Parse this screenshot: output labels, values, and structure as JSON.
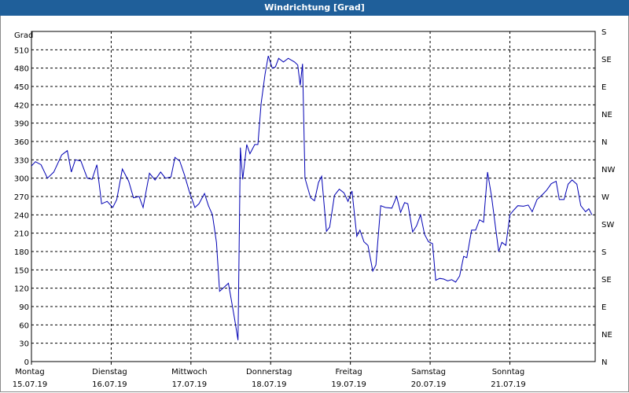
{
  "window": {
    "title": "Windrichtung [Grad]"
  },
  "colors": {
    "titlebar": "#1f5f9a",
    "line": "#0000b4",
    "grid": "#000000"
  },
  "chart_data": {
    "type": "line",
    "title": "Windrichtung [Grad]",
    "ylabel": "Grad",
    "ylim": [
      0,
      540
    ],
    "yticks": [
      0,
      30,
      60,
      90,
      120,
      150,
      180,
      210,
      240,
      270,
      300,
      330,
      360,
      390,
      420,
      450,
      480,
      510
    ],
    "right_axis_labels": [
      {
        "value": 0,
        "label": "N"
      },
      {
        "value": 30,
        "label": "NE"
      },
      {
        "value": 75,
        "label": "E"
      },
      {
        "value": 90,
        "label": ""
      },
      {
        "value": 105,
        "label": "SE"
      },
      {
        "value": 135,
        "label": "S"
      },
      {
        "value": 165,
        "label": "SW"
      },
      {
        "value": 195,
        "label": "W"
      },
      {
        "value": 225,
        "label": "NW"
      },
      {
        "value": 255,
        "label": "N"
      },
      {
        "value": 285,
        "label": "NE"
      },
      {
        "value": 315,
        "label": "E"
      },
      {
        "value": 345,
        "label": "SE"
      },
      {
        "value": 375,
        "label": "S"
      },
      {
        "value": 405,
        "label": "SW"
      },
      {
        "value": 435,
        "label": "W"
      },
      {
        "value": 465,
        "label": "NW"
      },
      {
        "value": 495,
        "label": "N"
      },
      {
        "value": 525,
        "label": "NE"
      }
    ],
    "right_axis_display": [
      {
        "value": 0,
        "label": "N"
      },
      {
        "value": 30,
        "label": "NE"
      },
      {
        "value": 60,
        "label": "E"
      },
      {
        "value": 90,
        "label": "SE"
      },
      {
        "value": 120,
        "label": "S"
      },
      {
        "value": 150,
        "label": "SW"
      },
      {
        "value": 180,
        "label": "W"
      },
      {
        "value": 210,
        "label": "NW"
      },
      {
        "value": 240,
        "label": "N"
      },
      {
        "value": 270,
        "label": "NE"
      },
      {
        "value": 300,
        "label": "E"
      },
      {
        "value": 330,
        "label": "SE"
      },
      {
        "value": 360,
        "label": "S"
      }
    ],
    "xlim": [
      0,
      7.07
    ],
    "day_labels": [
      {
        "day": "Montag",
        "date": "15.07.19"
      },
      {
        "day": "Dienstag",
        "date": "16.07.19"
      },
      {
        "day": "Mittwoch",
        "date": "17.07.19"
      },
      {
        "day": "Donnerstag",
        "date": "18.07.19"
      },
      {
        "day": "Freitag",
        "date": "19.07.19"
      },
      {
        "day": "Samstag",
        "date": "20.07.19"
      },
      {
        "day": "Sonntag",
        "date": "21.07.19"
      }
    ],
    "series": [
      {
        "points": [
          [
            0.0,
            320
          ],
          [
            0.05,
            327
          ],
          [
            0.12,
            322
          ],
          [
            0.2,
            300
          ],
          [
            0.28,
            310
          ],
          [
            0.38,
            338
          ],
          [
            0.45,
            345
          ],
          [
            0.5,
            310
          ],
          [
            0.55,
            330
          ],
          [
            0.62,
            328
          ],
          [
            0.7,
            300
          ],
          [
            0.76,
            298
          ],
          [
            0.82,
            322
          ],
          [
            0.88,
            258
          ],
          [
            0.95,
            262
          ],
          [
            1.02,
            252
          ],
          [
            1.07,
            265
          ],
          [
            1.14,
            315
          ],
          [
            1.22,
            295
          ],
          [
            1.28,
            268
          ],
          [
            1.35,
            270
          ],
          [
            1.4,
            252
          ],
          [
            1.48,
            308
          ],
          [
            1.55,
            297
          ],
          [
            1.62,
            310
          ],
          [
            1.68,
            300
          ],
          [
            1.75,
            302
          ],
          [
            1.8,
            334
          ],
          [
            1.86,
            328
          ],
          [
            1.92,
            305
          ],
          [
            1.98,
            278
          ],
          [
            2.05,
            252
          ],
          [
            2.1,
            258
          ],
          [
            2.17,
            275
          ],
          [
            2.22,
            255
          ],
          [
            2.27,
            240
          ],
          [
            2.32,
            195
          ],
          [
            2.36,
            115
          ],
          [
            2.42,
            122
          ],
          [
            2.47,
            128
          ],
          [
            2.51,
            98
          ],
          [
            2.55,
            68
          ],
          [
            2.59,
            35
          ],
          [
            2.62,
            350
          ],
          [
            2.65,
            298
          ],
          [
            2.7,
            355
          ],
          [
            2.74,
            340
          ],
          [
            2.8,
            355
          ],
          [
            2.84,
            355
          ],
          [
            2.88,
            422
          ],
          [
            2.93,
            470
          ],
          [
            2.97,
            500
          ],
          [
            3.02,
            480
          ],
          [
            3.06,
            482
          ],
          [
            3.1,
            496
          ],
          [
            3.16,
            490
          ],
          [
            3.22,
            496
          ],
          [
            3.3,
            490
          ],
          [
            3.34,
            485
          ],
          [
            3.37,
            452
          ],
          [
            3.4,
            487
          ],
          [
            3.43,
            300
          ],
          [
            3.5,
            268
          ],
          [
            3.55,
            263
          ],
          [
            3.6,
            293
          ],
          [
            3.64,
            303
          ],
          [
            3.7,
            213
          ],
          [
            3.74,
            220
          ],
          [
            3.8,
            272
          ],
          [
            3.86,
            282
          ],
          [
            3.92,
            276
          ],
          [
            3.97,
            262
          ],
          [
            4.02,
            279
          ],
          [
            4.08,
            205
          ],
          [
            4.12,
            215
          ],
          [
            4.17,
            196
          ],
          [
            4.22,
            190
          ],
          [
            4.28,
            148
          ],
          [
            4.32,
            158
          ],
          [
            4.38,
            255
          ],
          [
            4.44,
            252
          ],
          [
            4.52,
            251
          ],
          [
            4.58,
            270
          ],
          [
            4.63,
            244
          ],
          [
            4.68,
            260
          ],
          [
            4.72,
            258
          ],
          [
            4.78,
            212
          ],
          [
            4.83,
            222
          ],
          [
            4.88,
            240
          ],
          [
            4.93,
            208
          ],
          [
            4.98,
            196
          ],
          [
            5.03,
            193
          ],
          [
            5.07,
            133
          ],
          [
            5.12,
            136
          ],
          [
            5.17,
            135
          ],
          [
            5.22,
            132
          ],
          [
            5.27,
            134
          ],
          [
            5.32,
            130
          ],
          [
            5.37,
            140
          ],
          [
            5.42,
            172
          ],
          [
            5.46,
            170
          ],
          [
            5.52,
            215
          ],
          [
            5.57,
            215
          ],
          [
            5.62,
            232
          ],
          [
            5.67,
            228
          ],
          [
            5.72,
            310
          ],
          [
            5.77,
            270
          ],
          [
            5.82,
            220
          ],
          [
            5.86,
            180
          ],
          [
            5.9,
            195
          ],
          [
            5.95,
            190
          ],
          [
            6.0,
            240
          ],
          [
            6.05,
            248
          ],
          [
            6.1,
            255
          ],
          [
            6.17,
            254
          ],
          [
            6.23,
            256
          ],
          [
            6.28,
            245
          ],
          [
            6.34,
            265
          ],
          [
            6.4,
            272
          ],
          [
            6.46,
            280
          ],
          [
            6.52,
            291
          ],
          [
            6.58,
            295
          ],
          [
            6.62,
            265
          ],
          [
            6.68,
            265
          ],
          [
            6.73,
            290
          ],
          [
            6.78,
            297
          ],
          [
            6.84,
            290
          ],
          [
            6.89,
            255
          ],
          [
            6.95,
            245
          ],
          [
            6.99,
            250
          ],
          [
            7.03,
            240
          ]
        ]
      }
    ]
  }
}
